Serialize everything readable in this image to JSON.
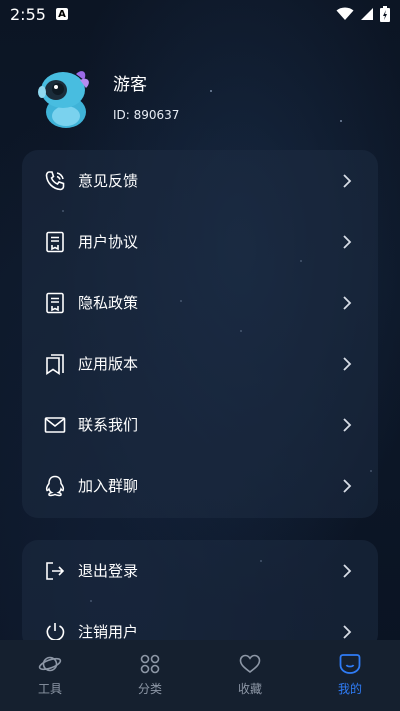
{
  "status_bar": {
    "time": "2:55",
    "notification_badge": "A"
  },
  "profile": {
    "username": "游客",
    "user_id": "ID: 890637"
  },
  "menu": [
    {
      "label": "意见反馈",
      "icon": "phone-icon"
    },
    {
      "label": "用户协议",
      "icon": "document-icon"
    },
    {
      "label": "隐私政策",
      "icon": "document-icon"
    },
    {
      "label": "应用版本",
      "icon": "bookmark-icon"
    },
    {
      "label": "联系我们",
      "icon": "mail-icon"
    },
    {
      "label": "加入群聊",
      "icon": "qq-icon"
    }
  ],
  "account_menu": [
    {
      "label": "退出登录",
      "icon": "logout-icon"
    },
    {
      "label": "注销用户",
      "icon": "power-icon"
    }
  ],
  "bottom_nav": {
    "tools": "工具",
    "categories": "分类",
    "favorites": "收藏",
    "mine": "我的",
    "active": "mine"
  },
  "colors": {
    "accent": "#2f7cf6",
    "card_bg": "#1e2c42",
    "nav_bg": "#15202f",
    "inactive_text": "#8d97a6"
  }
}
